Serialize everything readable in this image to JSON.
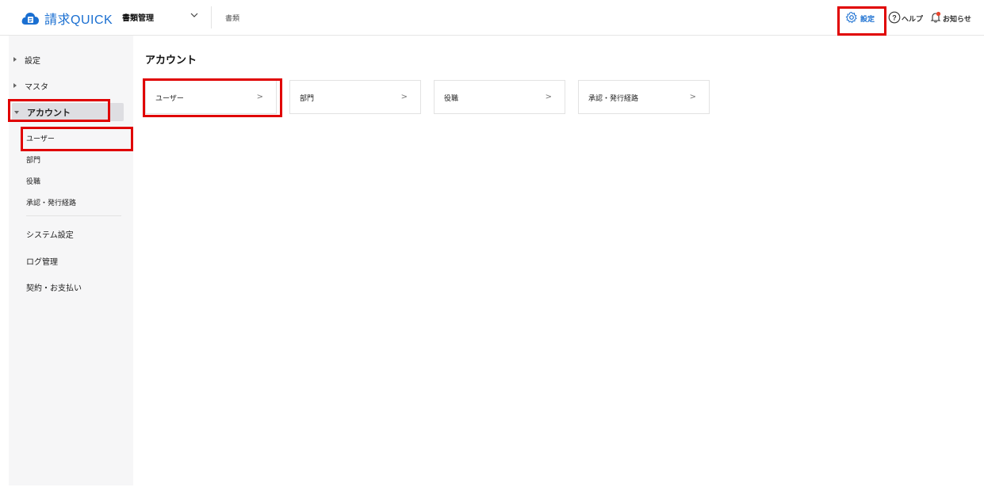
{
  "header": {
    "app_name": "請求QUICK",
    "app_selector": "書類管理",
    "breadcrumb": "書類",
    "settings_label": "設定",
    "help_label": "ヘルプ",
    "notifications_label": "お知らせ"
  },
  "sidebar": {
    "items": [
      {
        "label": "設定"
      },
      {
        "label": "マスタ"
      },
      {
        "label": "アカウント"
      }
    ],
    "account_children": [
      {
        "label": "ユーザー"
      },
      {
        "label": "部門"
      },
      {
        "label": "役職"
      },
      {
        "label": "承認・発行経路"
      }
    ],
    "bottom_items": [
      {
        "label": "システム設定"
      },
      {
        "label": "ログ管理"
      },
      {
        "label": "契約・お支払い"
      }
    ]
  },
  "main": {
    "title": "アカウント",
    "cards": [
      {
        "label": "ユーザー",
        "chevron": ">"
      },
      {
        "label": "部門",
        "chevron": ">"
      },
      {
        "label": "役職",
        "chevron": ">"
      },
      {
        "label": "承認・発行経路",
        "chevron": ">"
      }
    ]
  },
  "colors": {
    "brand": "#1a6fd1",
    "highlight": "#e00000",
    "notification_dot": "#e8452c"
  }
}
